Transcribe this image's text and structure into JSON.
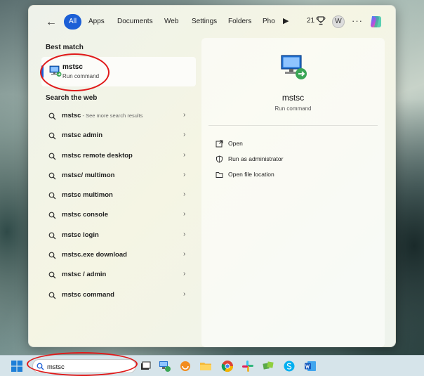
{
  "tabs": [
    {
      "label": "All",
      "active": true
    },
    {
      "label": "Apps"
    },
    {
      "label": "Documents"
    },
    {
      "label": "Web"
    },
    {
      "label": "Settings"
    },
    {
      "label": "Folders"
    },
    {
      "label": "Pho"
    }
  ],
  "header": {
    "points": "21",
    "avatar_initial": "W"
  },
  "best_match": {
    "heading": "Best match",
    "name": "mstsc",
    "subtitle": "Run command"
  },
  "web": {
    "heading": "Search the web",
    "items": [
      {
        "query": "mstsc",
        "hint": " - See more search results"
      },
      {
        "query": "mstsc admin"
      },
      {
        "query": "mstsc remote desktop"
      },
      {
        "query": "mstsc/ multimon"
      },
      {
        "query": "mstsc multimon"
      },
      {
        "query": "mstsc console"
      },
      {
        "query": "mstsc login"
      },
      {
        "query": "mstsc.exe download"
      },
      {
        "query": "mstsc / admin"
      },
      {
        "query": "mstsc command"
      }
    ]
  },
  "preview": {
    "name": "mstsc",
    "subtitle": "Run command",
    "actions": [
      {
        "label": "Open",
        "icon": "open-external-icon"
      },
      {
        "label": "Run as administrator",
        "icon": "shield-icon"
      },
      {
        "label": "Open file location",
        "icon": "folder-icon"
      }
    ]
  },
  "taskbar": {
    "search_value": "mstsc"
  },
  "colors": {
    "accent": "#1c5fd6",
    "annotation": "#e01a1a"
  }
}
